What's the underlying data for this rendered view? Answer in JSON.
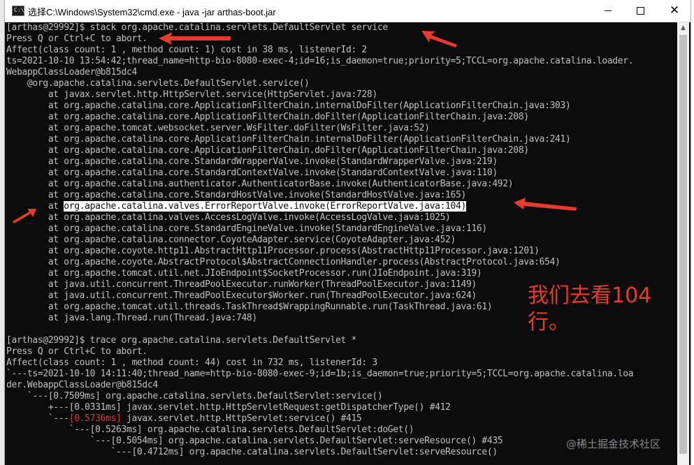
{
  "window": {
    "title": "选择C:\\Windows\\System32\\cmd.exe - java  -jar arthas-boot.jar",
    "icon": "cmd-icon",
    "minimize_glyph": "",
    "maximize_glyph": "",
    "close_glyph": "✕"
  },
  "console": {
    "lines": [
      {
        "text": "[arthas@29992]$ stack org.apache.catalina.servlets.DefaultServlet service"
      },
      {
        "text": "Press Q or Ctrl+C to abort."
      },
      {
        "text": "Affect(class count: 1 , method count: 1) cost in 38 ms, listenerId: 2"
      },
      {
        "text": "ts=2021-10-10 13:54:42;thread_name=http-bio-8080-exec-4;id=16;is_daemon=true;priority=5;TCCL=org.apache.catalina.loader."
      },
      {
        "text": "WebappClassLoader@b815dc4"
      },
      {
        "text": "    @org.apache.catalina.servlets.DefaultServlet.service()"
      },
      {
        "text": "        at javax.servlet.http.HttpServlet.service(HttpServlet.java:728)"
      },
      {
        "text": "        at org.apache.catalina.core.ApplicationFilterChain.internalDoFilter(ApplicationFilterChain.java:303)"
      },
      {
        "text": "        at org.apache.catalina.core.ApplicationFilterChain.doFilter(ApplicationFilterChain.java:208)"
      },
      {
        "text": "        at org.apache.tomcat.websocket.server.WsFilter.doFilter(WsFilter.java:52)"
      },
      {
        "text": "        at org.apache.catalina.core.ApplicationFilterChain.internalDoFilter(ApplicationFilterChain.java:241)"
      },
      {
        "text": "        at org.apache.catalina.core.ApplicationFilterChain.doFilter(ApplicationFilterChain.java:208)"
      },
      {
        "text": "        at org.apache.catalina.core.StandardWrapperValve.invoke(StandardWrapperValve.java:219)"
      },
      {
        "text": "        at org.apache.catalina.core.StandardContextValve.invoke(StandardContextValve.java:110)"
      },
      {
        "text": "        at org.apache.catalina.authenticator.AuthenticatorBase.invoke(AuthenticatorBase.java:492)"
      },
      {
        "text": "        at org.apache.catalina.core.StandardHostValve.invoke(StandardHostValve.java:165)"
      },
      {
        "prefix": "        at ",
        "highlight": "org.apache.catalina.valves.ErrorReportValve.invoke(ErrorReportValve.java:104)"
      },
      {
        "text": "        at org.apache.catalina.valves.AccessLogValve.invoke(AccessLogValve.java:1025)"
      },
      {
        "text": "        at org.apache.catalina.core.StandardEngineValve.invoke(StandardEngineValve.java:116)"
      },
      {
        "text": "        at org.apache.catalina.connector.CoyoteAdapter.service(CoyoteAdapter.java:452)"
      },
      {
        "text": "        at org.apache.coyote.http11.AbstractHttp11Processor.process(AbstractHttp11Processor.java:1201)"
      },
      {
        "text": "        at org.apache.coyote.AbstractProtocol$AbstractConnectionHandler.process(AbstractProtocol.java:654)"
      },
      {
        "text": "        at org.apache.tomcat.util.net.JIoEndpoint$SocketProcessor.run(JIoEndpoint.java:319)"
      },
      {
        "text": "        at java.util.concurrent.ThreadPoolExecutor.runWorker(ThreadPoolExecutor.java:1149)"
      },
      {
        "text": "        at java.util.concurrent.ThreadPoolExecutor$Worker.run(ThreadPoolExecutor.java:624)"
      },
      {
        "text": "        at org.apache.tomcat.util.threads.TaskThread$WrappingRunnable.run(TaskThread.java:61)"
      },
      {
        "text": "        at java.lang.Thread.run(Thread.java:748)"
      },
      {
        "text": ""
      },
      {
        "text": "[arthas@29992]$ trace org.apache.catalina.servlets.DefaultServlet *"
      },
      {
        "text": "Press Q or Ctrl+C to abort."
      },
      {
        "text": "Affect(class count: 1 , method count: 44) cost in 732 ms, listenerId: 3"
      },
      {
        "text": "`---ts=2021-10-10 14:11:40;thread_name=http-bio-8080-exec-9;id=1b;is_daemon=true;priority=5;TCCL=org.apache.catalina.loa"
      },
      {
        "text": "der.WebappClassLoader@b815dc4"
      },
      {
        "text": "    `---[0.7509ms] org.apache.catalina.servlets.DefaultServlet:service()"
      },
      {
        "text": "        +---[0.0331ms] javax.servlet.http.HttpServletRequest:getDispatcherType() #412"
      },
      {
        "prefix": "        `---",
        "red": "[0.5736ms]",
        "suffix": " javax.servlet.http.HttpServlet:service() #415"
      },
      {
        "text": "            `---[0.5263ms] org.apache.catalina.servlets.DefaultServlet:doGet()"
      },
      {
        "text": "                `---[0.5054ms] org.apache.catalina.servlets.DefaultServlet:serveResource() #435"
      },
      {
        "text": "                    `---[0.4712ms] org.apache.catalina.servlets.DefaultServlet:serveResource()"
      }
    ]
  },
  "annotation": {
    "line1": "我们去看104",
    "line2": "行。",
    "color": "#e83a2e"
  },
  "watermark": {
    "text": "@稀土掘金技术社区"
  },
  "colors": {
    "console_bg": "#0c0c0c",
    "console_fg": "#c0c0c0",
    "arrow": "#e83a2e",
    "highlight_bg": "#ffffff"
  }
}
